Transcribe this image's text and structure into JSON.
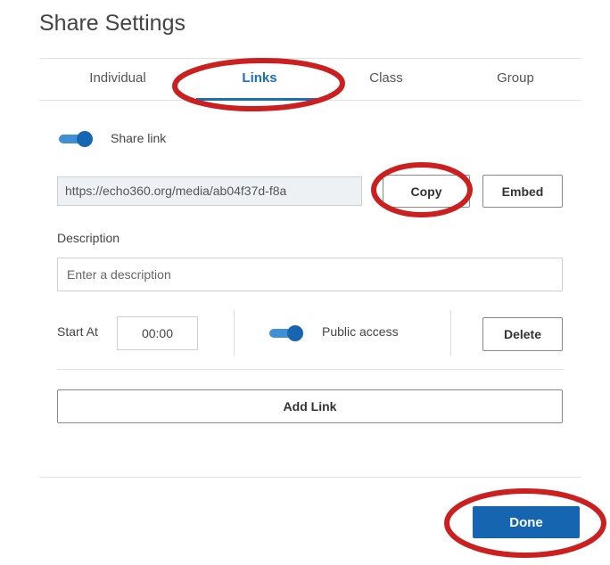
{
  "dialog": {
    "title": "Share Settings"
  },
  "tabs": [
    {
      "label": "Individual",
      "active": false
    },
    {
      "label": "Links",
      "active": true
    },
    {
      "label": "Class",
      "active": false
    },
    {
      "label": "Group",
      "active": false
    }
  ],
  "share_link": {
    "toggle_on": true,
    "label": "Share link",
    "url": "https://echo360.org/media/ab04f37d-f8a",
    "copy_label": "Copy",
    "embed_label": "Embed"
  },
  "description": {
    "label": "Description",
    "placeholder": "Enter a description",
    "value": ""
  },
  "link_options": {
    "start_at_label": "Start At",
    "start_at_value": "00:00",
    "public_access_on": true,
    "public_access_label": "Public access",
    "delete_label": "Delete"
  },
  "add_link_label": "Add Link",
  "done_label": "Done",
  "colors": {
    "accent": "#1565b0",
    "annotation": "#cc1f1f"
  }
}
